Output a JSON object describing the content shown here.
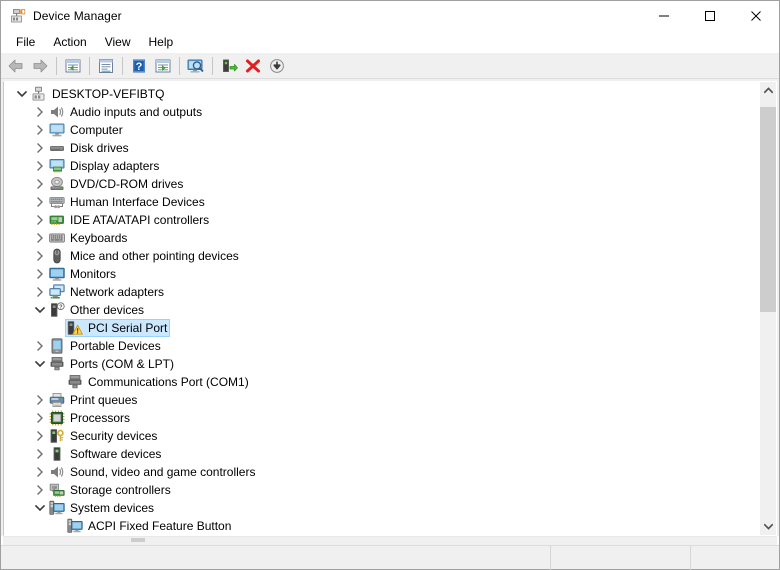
{
  "window": {
    "title": "Device Manager",
    "icon": "device-manager-icon",
    "buttons": {
      "minimize": "minimize-button",
      "maximize": "maximize-button",
      "close": "close-button"
    }
  },
  "menu": {
    "items": [
      {
        "label": "File",
        "name": "menu-file"
      },
      {
        "label": "Action",
        "name": "menu-action"
      },
      {
        "label": "View",
        "name": "menu-view"
      },
      {
        "label": "Help",
        "name": "menu-help"
      }
    ]
  },
  "toolbar": {
    "items": [
      {
        "name": "back-button",
        "icon": "back-arrow-icon",
        "tooltip": "Back"
      },
      {
        "name": "forward-button",
        "icon": "forward-arrow-icon",
        "tooltip": "Forward"
      },
      {
        "name": "separator-1",
        "icon": "separator"
      },
      {
        "name": "show-hide-console-tree-button",
        "icon": "console-tree-icon",
        "tooltip": "Show/Hide Console Tree"
      },
      {
        "name": "separator-2",
        "icon": "separator"
      },
      {
        "name": "properties-button",
        "icon": "properties-icon",
        "tooltip": "Properties"
      },
      {
        "name": "separator-3",
        "icon": "separator"
      },
      {
        "name": "help-button",
        "icon": "help-question-icon",
        "tooltip": "Help"
      },
      {
        "name": "show-action-pane-button",
        "icon": "action-pane-icon",
        "tooltip": "Show/Hide Action Pane"
      },
      {
        "name": "separator-4",
        "icon": "separator"
      },
      {
        "name": "scan-for-hardware-changes-button",
        "icon": "scan-monitor-icon",
        "tooltip": "Scan for hardware changes"
      },
      {
        "name": "separator-5",
        "icon": "separator"
      },
      {
        "name": "update-driver-button",
        "icon": "update-driver-icon",
        "tooltip": "Update Driver Software"
      },
      {
        "name": "uninstall-device-button",
        "icon": "red-x-icon",
        "tooltip": "Uninstall device"
      },
      {
        "name": "disable-device-button",
        "icon": "disable-down-arrow-icon",
        "tooltip": "Disable device"
      }
    ]
  },
  "tree": {
    "rows": [
      {
        "label": "DESKTOP-VEFIBTQ",
        "indent": 0,
        "expander": "expanded",
        "icon": "computer-root-icon",
        "name": "tree-item-desktop-vefibtq",
        "selected": false
      },
      {
        "label": "Audio inputs and outputs",
        "indent": 1,
        "expander": "collapsed",
        "icon": "speaker-icon",
        "name": "tree-item-audio-inputs-and-outputs",
        "selected": false
      },
      {
        "label": "Computer",
        "indent": 1,
        "expander": "collapsed",
        "icon": "monitor-icon",
        "name": "tree-item-computer",
        "selected": false
      },
      {
        "label": "Disk drives",
        "indent": 1,
        "expander": "collapsed",
        "icon": "disk-drive-icon",
        "name": "tree-item-disk-drives",
        "selected": false
      },
      {
        "label": "Display adapters",
        "indent": 1,
        "expander": "collapsed",
        "icon": "display-adapter-icon",
        "name": "tree-item-display-adapters",
        "selected": false
      },
      {
        "label": "DVD/CD-ROM drives",
        "indent": 1,
        "expander": "collapsed",
        "icon": "dvd-drive-icon",
        "name": "tree-item-dvd-cd-rom-drives",
        "selected": false
      },
      {
        "label": "Human Interface Devices",
        "indent": 1,
        "expander": "collapsed",
        "icon": "hid-icon",
        "name": "tree-item-human-interface-devices",
        "selected": false
      },
      {
        "label": "IDE ATA/ATAPI controllers",
        "indent": 1,
        "expander": "collapsed",
        "icon": "ide-controller-icon",
        "name": "tree-item-ide-ata-atapi-controllers",
        "selected": false
      },
      {
        "label": "Keyboards",
        "indent": 1,
        "expander": "collapsed",
        "icon": "keyboard-icon",
        "name": "tree-item-keyboards",
        "selected": false
      },
      {
        "label": "Mice and other pointing devices",
        "indent": 1,
        "expander": "collapsed",
        "icon": "mouse-icon",
        "name": "tree-item-mice-and-other-pointing-devices",
        "selected": false
      },
      {
        "label": "Monitors",
        "indent": 1,
        "expander": "collapsed",
        "icon": "monitor-blue-icon",
        "name": "tree-item-monitors",
        "selected": false
      },
      {
        "label": "Network adapters",
        "indent": 1,
        "expander": "collapsed",
        "icon": "network-adapter-icon",
        "name": "tree-item-network-adapters",
        "selected": false
      },
      {
        "label": "Other devices",
        "indent": 1,
        "expander": "expanded",
        "icon": "unknown-device-icon",
        "name": "tree-item-other-devices",
        "selected": false
      },
      {
        "label": "PCI Serial Port",
        "indent": 2,
        "expander": "none",
        "icon": "unknown-device-warning-icon",
        "name": "tree-item-pci-serial-port",
        "selected": true
      },
      {
        "label": "Portable Devices",
        "indent": 1,
        "expander": "collapsed",
        "icon": "portable-device-icon",
        "name": "tree-item-portable-devices",
        "selected": false
      },
      {
        "label": "Ports (COM & LPT)",
        "indent": 1,
        "expander": "expanded",
        "icon": "port-icon",
        "name": "tree-item-ports-com-and-lpt",
        "selected": false
      },
      {
        "label": "Communications Port (COM1)",
        "indent": 2,
        "expander": "none",
        "icon": "port-icon",
        "name": "tree-item-communications-port-com1",
        "selected": false
      },
      {
        "label": "Print queues",
        "indent": 1,
        "expander": "collapsed",
        "icon": "printer-icon",
        "name": "tree-item-print-queues",
        "selected": false
      },
      {
        "label": "Processors",
        "indent": 1,
        "expander": "collapsed",
        "icon": "processor-icon",
        "name": "tree-item-processors",
        "selected": false
      },
      {
        "label": "Security devices",
        "indent": 1,
        "expander": "collapsed",
        "icon": "security-device-icon",
        "name": "tree-item-security-devices",
        "selected": false
      },
      {
        "label": "Software devices",
        "indent": 1,
        "expander": "collapsed",
        "icon": "software-device-icon",
        "name": "tree-item-software-devices",
        "selected": false
      },
      {
        "label": "Sound, video and game controllers",
        "indent": 1,
        "expander": "collapsed",
        "icon": "speaker-icon",
        "name": "tree-item-sound-video-and-game-controllers",
        "selected": false
      },
      {
        "label": "Storage controllers",
        "indent": 1,
        "expander": "collapsed",
        "icon": "storage-controller-icon",
        "name": "tree-item-storage-controllers",
        "selected": false
      },
      {
        "label": "System devices",
        "indent": 1,
        "expander": "expanded",
        "icon": "system-device-icon",
        "name": "tree-item-system-devices",
        "selected": false
      },
      {
        "label": "ACPI Fixed Feature Button",
        "indent": 2,
        "expander": "none",
        "icon": "system-device-icon",
        "name": "tree-item-acpi-fixed-feature-button",
        "selected": false
      }
    ]
  },
  "scrollbars": {
    "vertical": {
      "name": "vertical-scrollbar",
      "up_arrow": "scroll-up-arrow-icon",
      "down_arrow": "scroll-down-arrow-icon"
    },
    "horizontal": {
      "name": "horizontal-scrollbar"
    }
  },
  "statusbar": {
    "main": "",
    "mid": "",
    "end": ""
  },
  "colors": {
    "selection_fill": "#cce8ff",
    "selection_border": "#99d1ff",
    "chrome": "#f0f0f0",
    "scroll_thumb": "#cdcdcd",
    "warning_yellow": "#ffd44f",
    "uninstall_red": "#e02020",
    "update_green": "#4caf2a"
  }
}
